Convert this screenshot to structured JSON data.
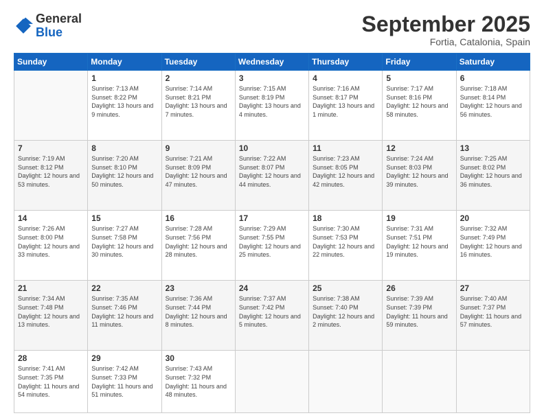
{
  "logo": {
    "general": "General",
    "blue": "Blue"
  },
  "header": {
    "month": "September 2025",
    "location": "Fortia, Catalonia, Spain"
  },
  "days_of_week": [
    "Sunday",
    "Monday",
    "Tuesday",
    "Wednesday",
    "Thursday",
    "Friday",
    "Saturday"
  ],
  "weeks": [
    [
      {
        "day": "",
        "sunrise": "",
        "sunset": "",
        "daylight": ""
      },
      {
        "day": "1",
        "sunrise": "Sunrise: 7:13 AM",
        "sunset": "Sunset: 8:22 PM",
        "daylight": "Daylight: 13 hours and 9 minutes."
      },
      {
        "day": "2",
        "sunrise": "Sunrise: 7:14 AM",
        "sunset": "Sunset: 8:21 PM",
        "daylight": "Daylight: 13 hours and 7 minutes."
      },
      {
        "day": "3",
        "sunrise": "Sunrise: 7:15 AM",
        "sunset": "Sunset: 8:19 PM",
        "daylight": "Daylight: 13 hours and 4 minutes."
      },
      {
        "day": "4",
        "sunrise": "Sunrise: 7:16 AM",
        "sunset": "Sunset: 8:17 PM",
        "daylight": "Daylight: 13 hours and 1 minute."
      },
      {
        "day": "5",
        "sunrise": "Sunrise: 7:17 AM",
        "sunset": "Sunset: 8:16 PM",
        "daylight": "Daylight: 12 hours and 58 minutes."
      },
      {
        "day": "6",
        "sunrise": "Sunrise: 7:18 AM",
        "sunset": "Sunset: 8:14 PM",
        "daylight": "Daylight: 12 hours and 56 minutes."
      }
    ],
    [
      {
        "day": "7",
        "sunrise": "Sunrise: 7:19 AM",
        "sunset": "Sunset: 8:12 PM",
        "daylight": "Daylight: 12 hours and 53 minutes."
      },
      {
        "day": "8",
        "sunrise": "Sunrise: 7:20 AM",
        "sunset": "Sunset: 8:10 PM",
        "daylight": "Daylight: 12 hours and 50 minutes."
      },
      {
        "day": "9",
        "sunrise": "Sunrise: 7:21 AM",
        "sunset": "Sunset: 8:09 PM",
        "daylight": "Daylight: 12 hours and 47 minutes."
      },
      {
        "day": "10",
        "sunrise": "Sunrise: 7:22 AM",
        "sunset": "Sunset: 8:07 PM",
        "daylight": "Daylight: 12 hours and 44 minutes."
      },
      {
        "day": "11",
        "sunrise": "Sunrise: 7:23 AM",
        "sunset": "Sunset: 8:05 PM",
        "daylight": "Daylight: 12 hours and 42 minutes."
      },
      {
        "day": "12",
        "sunrise": "Sunrise: 7:24 AM",
        "sunset": "Sunset: 8:03 PM",
        "daylight": "Daylight: 12 hours and 39 minutes."
      },
      {
        "day": "13",
        "sunrise": "Sunrise: 7:25 AM",
        "sunset": "Sunset: 8:02 PM",
        "daylight": "Daylight: 12 hours and 36 minutes."
      }
    ],
    [
      {
        "day": "14",
        "sunrise": "Sunrise: 7:26 AM",
        "sunset": "Sunset: 8:00 PM",
        "daylight": "Daylight: 12 hours and 33 minutes."
      },
      {
        "day": "15",
        "sunrise": "Sunrise: 7:27 AM",
        "sunset": "Sunset: 7:58 PM",
        "daylight": "Daylight: 12 hours and 30 minutes."
      },
      {
        "day": "16",
        "sunrise": "Sunrise: 7:28 AM",
        "sunset": "Sunset: 7:56 PM",
        "daylight": "Daylight: 12 hours and 28 minutes."
      },
      {
        "day": "17",
        "sunrise": "Sunrise: 7:29 AM",
        "sunset": "Sunset: 7:55 PM",
        "daylight": "Daylight: 12 hours and 25 minutes."
      },
      {
        "day": "18",
        "sunrise": "Sunrise: 7:30 AM",
        "sunset": "Sunset: 7:53 PM",
        "daylight": "Daylight: 12 hours and 22 minutes."
      },
      {
        "day": "19",
        "sunrise": "Sunrise: 7:31 AM",
        "sunset": "Sunset: 7:51 PM",
        "daylight": "Daylight: 12 hours and 19 minutes."
      },
      {
        "day": "20",
        "sunrise": "Sunrise: 7:32 AM",
        "sunset": "Sunset: 7:49 PM",
        "daylight": "Daylight: 12 hours and 16 minutes."
      }
    ],
    [
      {
        "day": "21",
        "sunrise": "Sunrise: 7:34 AM",
        "sunset": "Sunset: 7:48 PM",
        "daylight": "Daylight: 12 hours and 13 minutes."
      },
      {
        "day": "22",
        "sunrise": "Sunrise: 7:35 AM",
        "sunset": "Sunset: 7:46 PM",
        "daylight": "Daylight: 12 hours and 11 minutes."
      },
      {
        "day": "23",
        "sunrise": "Sunrise: 7:36 AM",
        "sunset": "Sunset: 7:44 PM",
        "daylight": "Daylight: 12 hours and 8 minutes."
      },
      {
        "day": "24",
        "sunrise": "Sunrise: 7:37 AM",
        "sunset": "Sunset: 7:42 PM",
        "daylight": "Daylight: 12 hours and 5 minutes."
      },
      {
        "day": "25",
        "sunrise": "Sunrise: 7:38 AM",
        "sunset": "Sunset: 7:40 PM",
        "daylight": "Daylight: 12 hours and 2 minutes."
      },
      {
        "day": "26",
        "sunrise": "Sunrise: 7:39 AM",
        "sunset": "Sunset: 7:39 PM",
        "daylight": "Daylight: 11 hours and 59 minutes."
      },
      {
        "day": "27",
        "sunrise": "Sunrise: 7:40 AM",
        "sunset": "Sunset: 7:37 PM",
        "daylight": "Daylight: 11 hours and 57 minutes."
      }
    ],
    [
      {
        "day": "28",
        "sunrise": "Sunrise: 7:41 AM",
        "sunset": "Sunset: 7:35 PM",
        "daylight": "Daylight: 11 hours and 54 minutes."
      },
      {
        "day": "29",
        "sunrise": "Sunrise: 7:42 AM",
        "sunset": "Sunset: 7:33 PM",
        "daylight": "Daylight: 11 hours and 51 minutes."
      },
      {
        "day": "30",
        "sunrise": "Sunrise: 7:43 AM",
        "sunset": "Sunset: 7:32 PM",
        "daylight": "Daylight: 11 hours and 48 minutes."
      },
      {
        "day": "",
        "sunrise": "",
        "sunset": "",
        "daylight": ""
      },
      {
        "day": "",
        "sunrise": "",
        "sunset": "",
        "daylight": ""
      },
      {
        "day": "",
        "sunrise": "",
        "sunset": "",
        "daylight": ""
      },
      {
        "day": "",
        "sunrise": "",
        "sunset": "",
        "daylight": ""
      }
    ]
  ]
}
